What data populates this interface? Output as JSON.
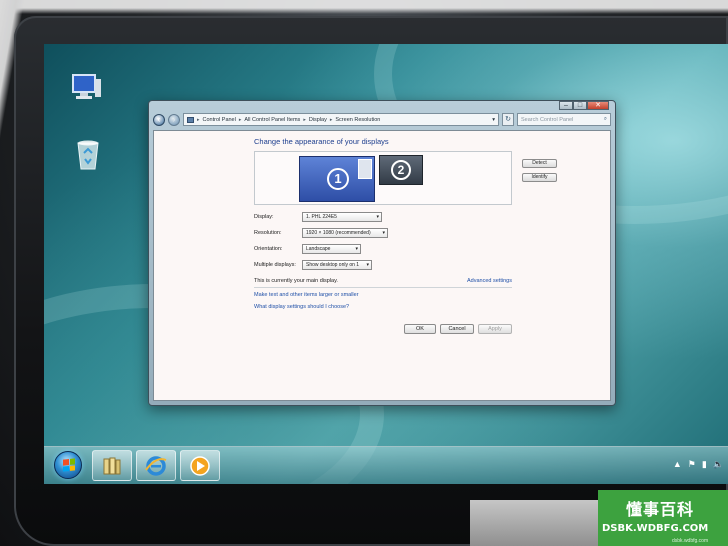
{
  "window": {
    "caption_buttons": {
      "minimize": "–",
      "maximize": "□",
      "close": "✕"
    },
    "address_bar": {
      "breadcrumb": [
        "Control Panel",
        "All Control Panel Items",
        "Display",
        "Screen Resolution"
      ],
      "separator": "▸",
      "search_placeholder": "Search Control Panel"
    },
    "heading": "Change the appearance of your displays",
    "monitors": [
      {
        "number": "1",
        "selected": true
      },
      {
        "number": "2",
        "selected": false
      }
    ],
    "buttons": {
      "detect": "Detect",
      "identify": "Identify"
    },
    "settings": {
      "display": {
        "label": "Display:",
        "value": "1. PHL 224E5"
      },
      "resolution": {
        "label": "Resolution:",
        "value": "1920 × 1080 (recommended)"
      },
      "orientation": {
        "label": "Orientation:",
        "value": "Landscape"
      },
      "multiple_displays": {
        "label": "Multiple displays:",
        "value": "Show desktop only on 1"
      }
    },
    "info_text": "This is currently your main display.",
    "advanced_link": "Advanced settings",
    "links": [
      "Make text and other items larger or smaller",
      "What display settings should I choose?"
    ],
    "footer": {
      "ok": "OK",
      "cancel": "Cancel",
      "apply": "Apply"
    }
  },
  "taskbar": {
    "items": [
      {
        "icon": "start-orb-icon"
      },
      {
        "icon": "libraries-folder-icon"
      },
      {
        "icon": "internet-explorer-icon"
      },
      {
        "icon": "media-player-icon"
      }
    ],
    "tray": {
      "arrow": "▲",
      "flag": "⚑",
      "network": "▮",
      "volume": "🔈"
    }
  },
  "watermark": {
    "title": "懂事百科",
    "subtitle": "DSBK.WDBFG.COM",
    "small": "dsbk.wdbfg.com"
  },
  "colors": {
    "accent_blue": "#1e4fa7",
    "selected_monitor": "#2e4ea6",
    "watermark_green": "#3da23f"
  }
}
